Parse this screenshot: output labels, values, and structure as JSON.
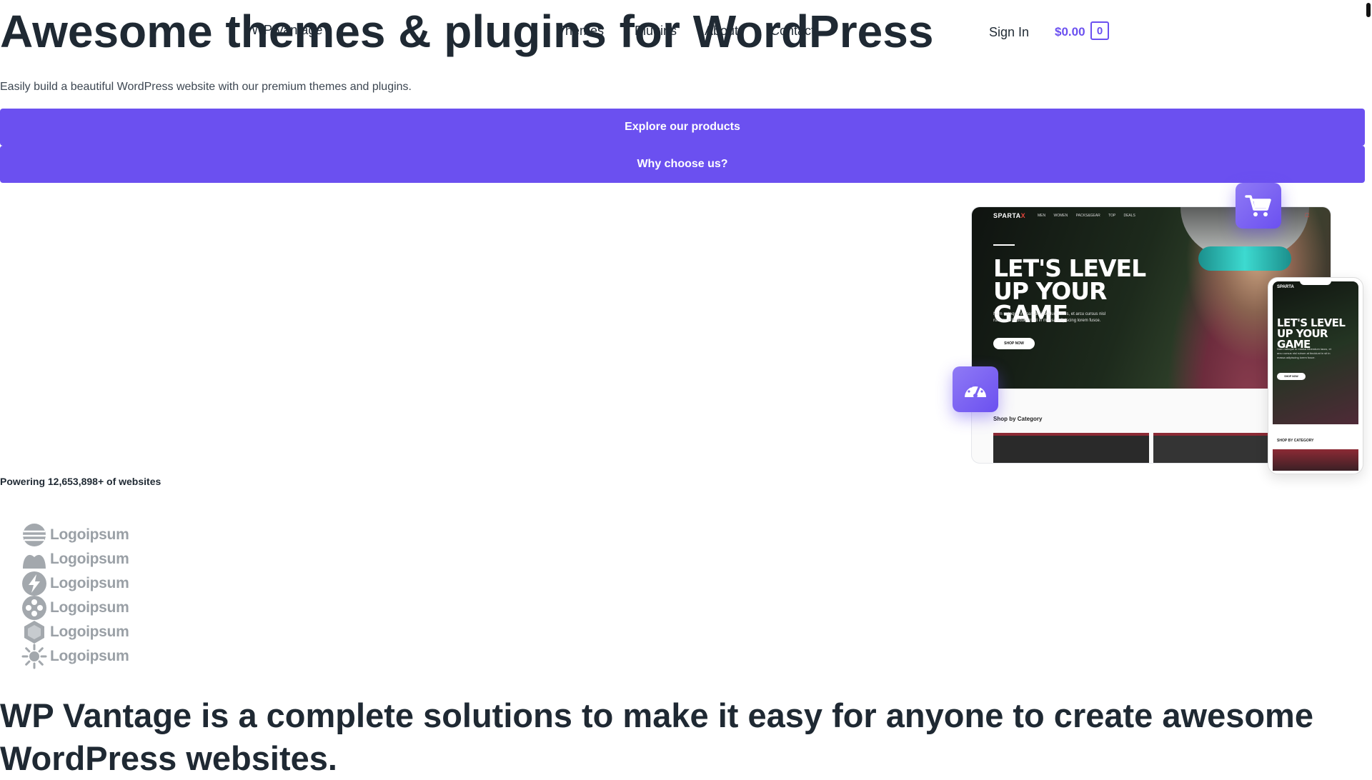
{
  "nav": {
    "logo": "WP Vantage",
    "items": [
      "Themes",
      "Plugins",
      "About",
      "Contact"
    ],
    "signin": "Sign In",
    "cart_total": "$0.00",
    "cart_count": "0"
  },
  "hero": {
    "headline": "Awesome themes & plugins for WordPress",
    "subtitle": "Easily build a beautiful WordPress website with our premium themes and plugins.",
    "btn_explore": "Explore our products",
    "btn_why": "Why choose us?"
  },
  "mockup": {
    "brand_main": "SPARTA",
    "brand_accent": "X",
    "menu": "Men Women Packs&Gear Top Deals",
    "headline": "LET'S LEVEL UP YOUR GAME",
    "text": "Nam natoque in massa bibendum lacus, et arcu cursus nisl rutrum at tincidunt in sit in massa adipiscing lorem fusce.",
    "shop_button": "SHOP NOW",
    "category": "Shop by Category",
    "phone_brand": "SPARTA",
    "phone_category": "SHOP BY CATEGORY"
  },
  "stats": {
    "powering": "Powering 12,653,898+ of websites"
  },
  "logos": [
    "Logoipsum",
    "Logoipsum",
    "Logoipsum",
    "Logoipsum",
    "Logoipsum",
    "Logoipsum"
  ],
  "logo_icons": [
    "globe-icon",
    "crown-icon",
    "bolt-icon",
    "dots-icon",
    "hexagon-icon",
    "sun-icon"
  ],
  "solution": {
    "heading": "WP Vantage is a complete solutions to make it easy for anyone to create awesome WordPress websites."
  },
  "colors": {
    "accent": "#6b50f0",
    "text": "#1f2933",
    "logo_gray": "#9aa0a6"
  }
}
